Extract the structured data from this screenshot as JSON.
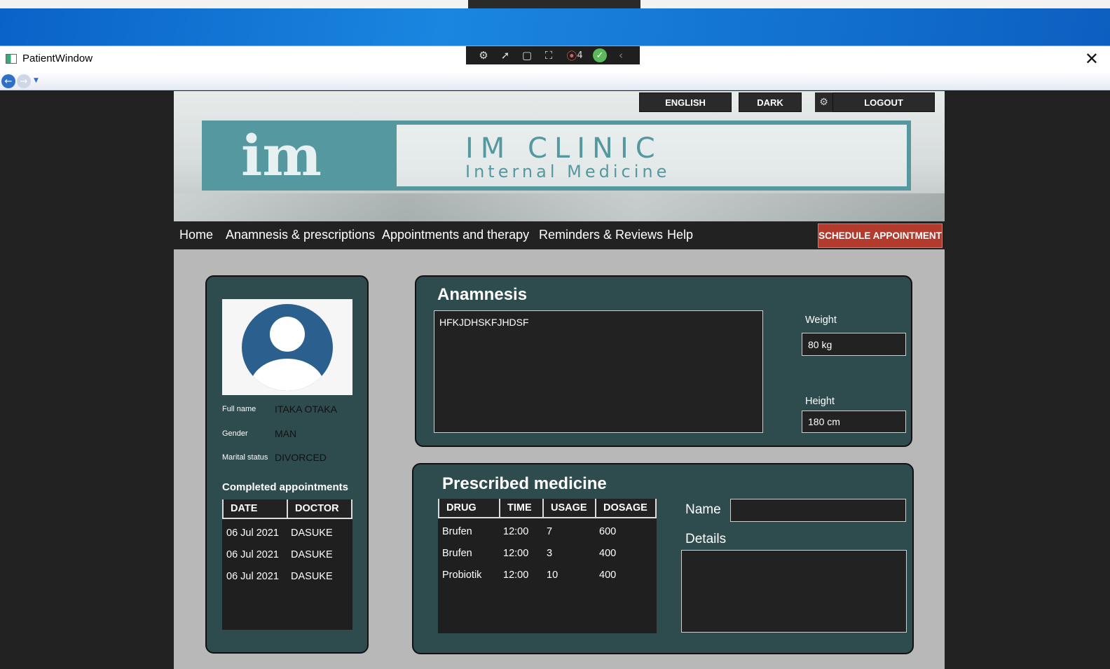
{
  "window": {
    "title": "PatientWindow",
    "close_glyph": "✕"
  },
  "debug_toolbar": {
    "count": "4"
  },
  "header": {
    "language_button": "ENGLISH",
    "theme_button": "DARK",
    "logout_button": "LOGOUT",
    "logo_title": "IM CLINIC",
    "logo_subtitle": "Internal Medicine"
  },
  "menu": {
    "items": [
      "Home",
      "Anamnesis & prescriptions",
      "Appointments and therapy",
      "Reminders & Reviews",
      "Help"
    ],
    "schedule_button": "SCHEDULE APPOINTMENT"
  },
  "profile": {
    "full_name_label": "Full name",
    "full_name": "ITAKA OTAKA",
    "gender_label": "Gender",
    "gender": "MAN",
    "marital_label": "Marital status",
    "marital": "DIVORCED",
    "completed_title": "Completed appointments",
    "columns": [
      "DATE",
      "DOCTOR"
    ],
    "rows": [
      [
        "06 Jul 2021",
        "DASUKE"
      ],
      [
        "06 Jul 2021",
        "DASUKE"
      ],
      [
        "06 Jul 2021",
        "DASUKE"
      ]
    ]
  },
  "anamnesis": {
    "title": "Anamnesis",
    "text": "HFKJDHSKFJHDSF",
    "weight_label": "Weight",
    "weight": "80 kg",
    "height_label": "Height",
    "height": "180 cm"
  },
  "prescribed": {
    "title": "Prescribed medicine",
    "columns": [
      "DRUG",
      "TIME",
      "USAGE",
      "DOSAGE"
    ],
    "rows": [
      [
        "Brufen",
        "12:00",
        "7",
        "600"
      ],
      [
        "Brufen",
        "12:00",
        "3",
        "400"
      ],
      [
        "Probiotik",
        "12:00",
        "10",
        "400"
      ]
    ],
    "name_label": "Name",
    "name_value": "",
    "details_label": "Details",
    "details_value": ""
  },
  "colors": {
    "panel": "#2e4b4e",
    "accent_teal": "#56989f",
    "schedule_red": "#b23b2e",
    "avatar_blue": "#2b5f8e"
  }
}
